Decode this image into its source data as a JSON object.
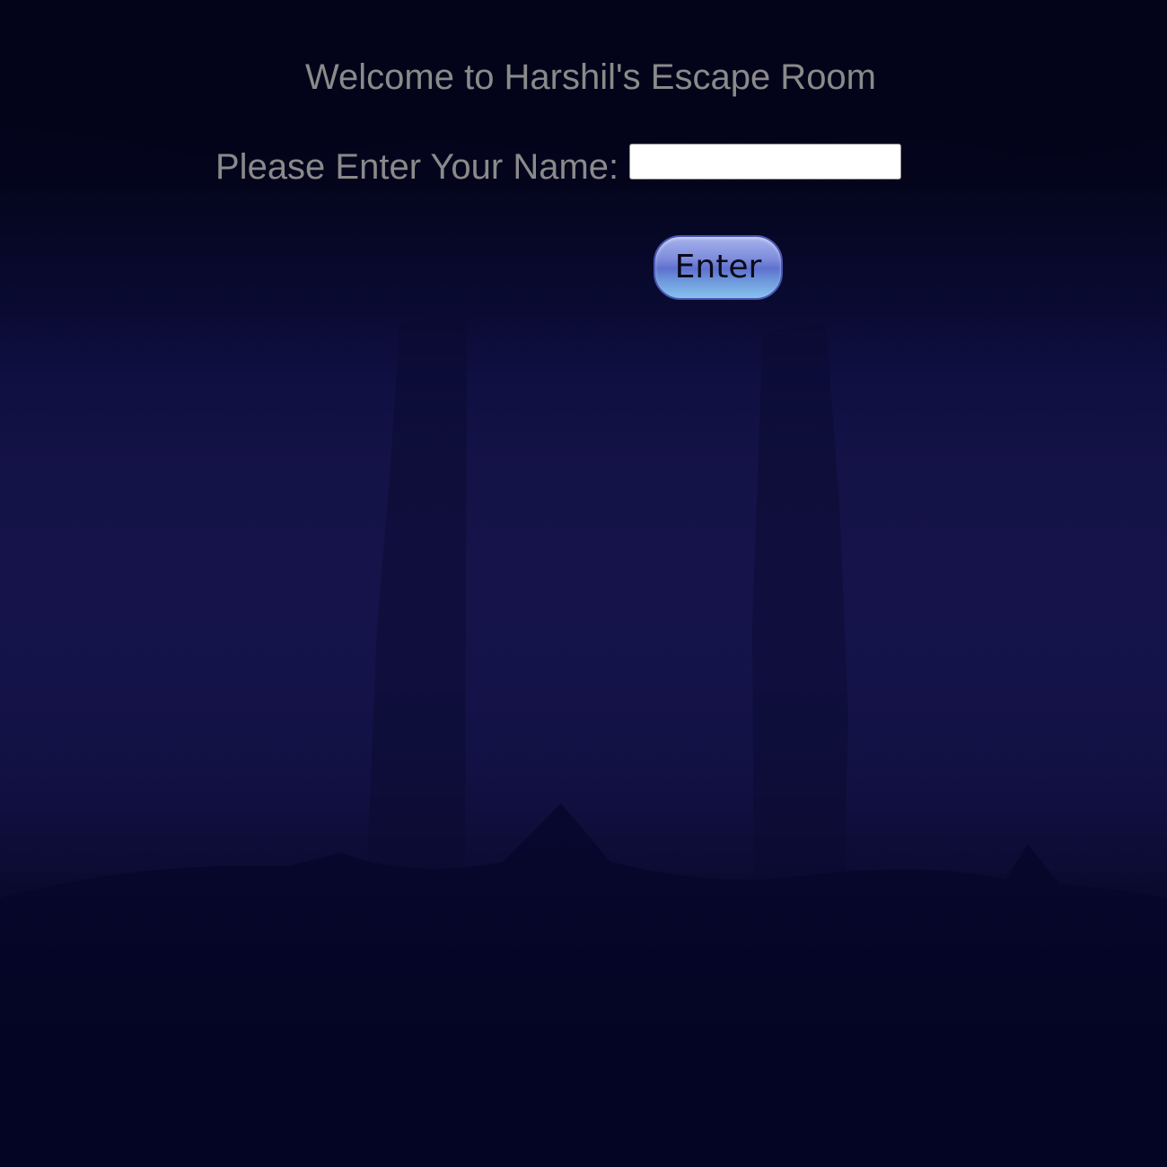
{
  "page": {
    "title": "Welcome to Harshil's Escape Room",
    "name_label": "Please Enter Your Name:",
    "name_input_value": "",
    "enter_button_label": "Enter"
  },
  "colors": {
    "background_dark": "#03041a",
    "background_mid": "#15134a",
    "text": "#8a8a8a",
    "button_top": "#a6b2ec",
    "button_bottom": "#86c2ef"
  }
}
